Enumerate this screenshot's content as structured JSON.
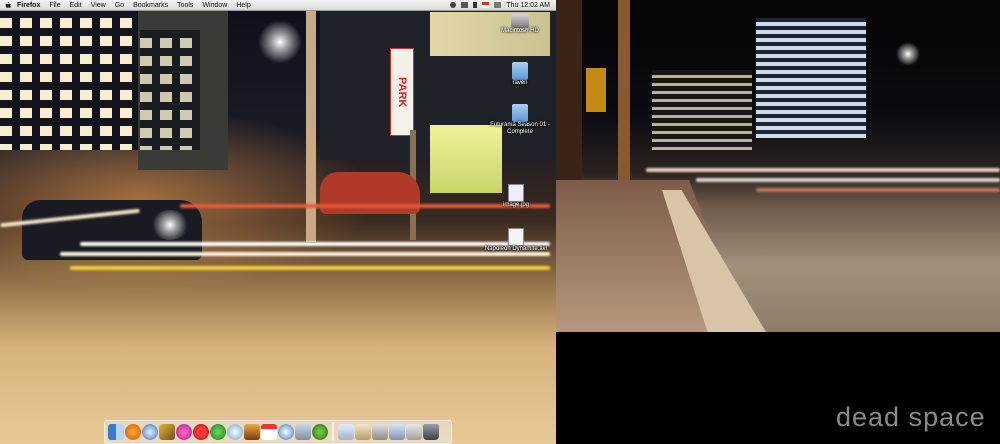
{
  "menubar": {
    "apple_icon": "apple-icon",
    "items": [
      "Firefox",
      "File",
      "Edit",
      "View",
      "Go",
      "Bookmarks",
      "Tools",
      "Window",
      "Help"
    ],
    "clock": "Thu 12:02 AM"
  },
  "desktop_icons": [
    {
      "label": "Macintosh HD",
      "icon": "hard-drive-icon"
    },
    {
      "label": "raven",
      "icon": "folder-icon"
    },
    {
      "label": "Futurama Season 01 - Complete",
      "icon": "folder-icon"
    },
    {
      "label": "image.jpg",
      "icon": "image-file-icon"
    },
    {
      "label": "Napoleon Dynamite.avi",
      "icon": "video-file-icon"
    }
  ],
  "signs": {
    "park": "PARK"
  },
  "watermark": "dead space",
  "colors": {
    "menubar": "#e6e6e6",
    "streak_white": "#ffffff",
    "streak_yellow": "#f5d03a",
    "streak_red": "#e85a3a"
  }
}
